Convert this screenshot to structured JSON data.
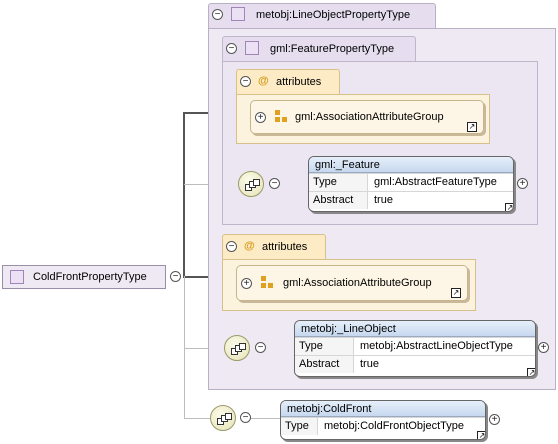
{
  "root": {
    "label": "ColdFrontPropertyType",
    "expander": "−"
  },
  "line_object_type": {
    "label": "metobj:LineObjectPropertyType",
    "expander": "−"
  },
  "feature_property_type": {
    "label": "gml:FeaturePropertyType",
    "expander": "−"
  },
  "attributes_1": {
    "label": "attributes",
    "at": "@",
    "expander": "−",
    "group": {
      "label": "gml:AssociationAttributeGroup",
      "expander": "+"
    }
  },
  "attributes_2": {
    "label": "attributes",
    "at": "@",
    "expander": "−",
    "group": {
      "label": "gml:AssociationAttributeGroup",
      "expander": "+"
    }
  },
  "feature_element": {
    "title": "gml:_Feature",
    "expander": "+",
    "rows": [
      {
        "key": "Type",
        "value": "gml:AbstractFeatureType"
      },
      {
        "key": "Abstract",
        "value": "true"
      }
    ]
  },
  "line_object_element": {
    "title": "metobj:_LineObject",
    "expander": "+",
    "rows": [
      {
        "key": "Type",
        "value": "metobj:AbstractLineObjectType"
      },
      {
        "key": "Abstract",
        "value": "true"
      }
    ]
  },
  "cold_front_element": {
    "title": "metobj:ColdFront",
    "expander": "+",
    "rows": [
      {
        "key": "Type",
        "value": "metobj:ColdFrontObjectType"
      }
    ]
  },
  "sequence_expander": "−",
  "link_glyph": "↗",
  "colors": {
    "type_fill": "#efe9f4",
    "attr_fill": "#fcebc4",
    "element_header": "#c6d8ef",
    "sequence_fill": "#e5e2b7"
  }
}
